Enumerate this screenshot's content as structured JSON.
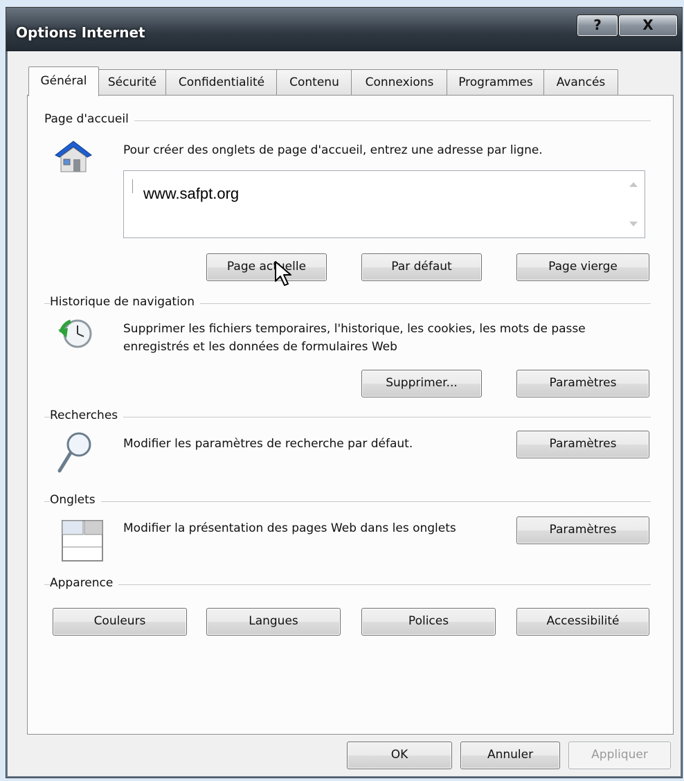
{
  "window": {
    "title": "Options Internet",
    "help_label": "?",
    "close_label": "X"
  },
  "tabs": [
    {
      "label": "Général",
      "active": true
    },
    {
      "label": "Sécurité"
    },
    {
      "label": "Confidentialité"
    },
    {
      "label": "Contenu"
    },
    {
      "label": "Connexions"
    },
    {
      "label": "Programmes"
    },
    {
      "label": "Avancés"
    }
  ],
  "homepage": {
    "title": "Page d'accueil",
    "description": "Pour créer des onglets de page d'accueil, entrez une adresse par ligne.",
    "value": "www.safpt.org",
    "buttons": [
      "Page actuelle",
      "Par défaut",
      "Page vierge"
    ],
    "icon": "house-icon"
  },
  "history": {
    "title": "Historique de navigation",
    "description_line1": "Supprimer les fichiers temporaires, l'historique, les cookies, les mots de passe",
    "description_line2": "enregistrés et les données de formulaires Web",
    "buttons": [
      "Supprimer...",
      "Paramètres"
    ],
    "icon": "history-clock-icon"
  },
  "search": {
    "title": "Recherches",
    "description": "Modifier les paramètres de recherche par défaut.",
    "button": "Paramètres",
    "icon": "magnifier-icon"
  },
  "tabs_section": {
    "title": "Onglets",
    "description": "Modifier la présentation des pages Web dans les onglets",
    "button": "Paramètres",
    "icon": "tabs-window-icon"
  },
  "appearance": {
    "title": "Apparence",
    "buttons": [
      "Couleurs",
      "Langues",
      "Polices",
      "Accessibilité"
    ]
  },
  "footer": {
    "ok": "OK",
    "cancel": "Annuler",
    "apply": "Appliquer"
  }
}
